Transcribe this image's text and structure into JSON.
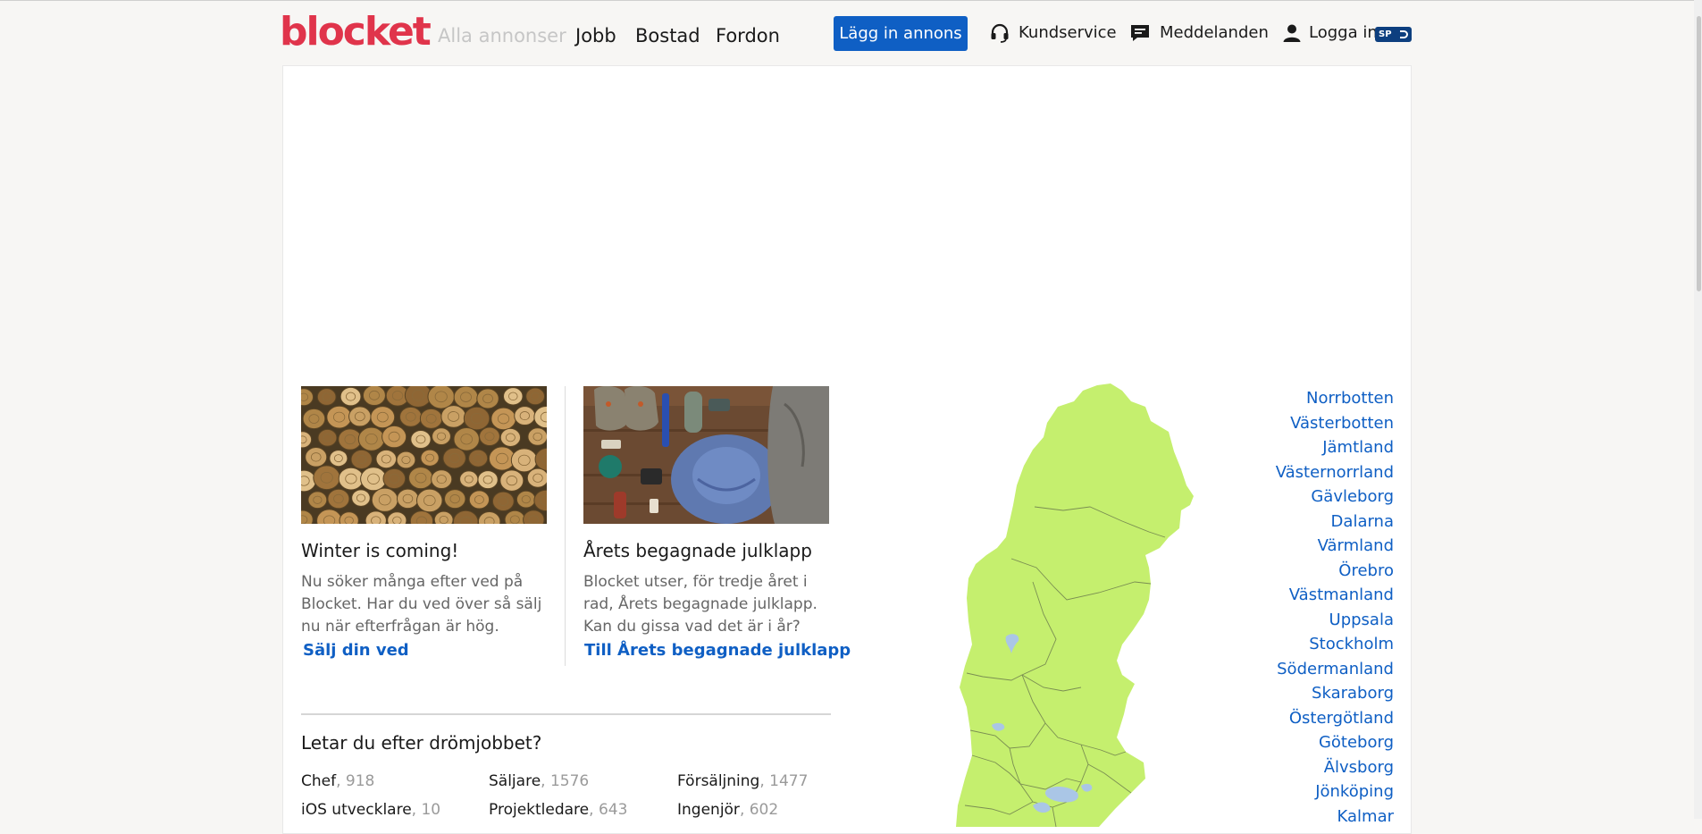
{
  "header": {
    "logo": "blocket",
    "nav": [
      "Alla annonser",
      "Jobb",
      "Bostad",
      "Fordon"
    ],
    "post_button": "Lägg in annons",
    "customer_service": "Kundservice",
    "messages": "Meddelanden",
    "login": "Logga in",
    "spid_badge": "SP"
  },
  "cards": [
    {
      "title": "Winter is coming!",
      "text": "Nu söker många efter ved på Blocket. Har du ved över så sälj nu när efterfrågan är hög.",
      "link": "Sälj din ved"
    },
    {
      "title": "Årets begagnade julklapp",
      "text": "Blocket utser, för tredje året i rad, Årets begagnade julklapp. Kan du gissa vad det är i år?",
      "link": "Till Årets begagnade julklapp"
    }
  ],
  "jobs": {
    "title": "Letar du efter drömjobbet?",
    "items": [
      {
        "name": "Chef",
        "count": ", 918"
      },
      {
        "name": "Säljare",
        "count": ", 1576"
      },
      {
        "name": "Försäljning",
        "count": ", 1477"
      },
      {
        "name": "iOS utvecklare",
        "count": ", 10"
      },
      {
        "name": "Projektledare",
        "count": ", 643"
      },
      {
        "name": "Ingenjör",
        "count": ", 602"
      }
    ]
  },
  "regions": [
    "Norrbotten",
    "Västerbotten",
    "Jämtland",
    "Västernorrland",
    "Gävleborg",
    "Dalarna",
    "Värmland",
    "Örebro",
    "Västmanland",
    "Uppsala",
    "Stockholm",
    "Södermanland",
    "Skaraborg",
    "Östergötland",
    "Göteborg",
    "Älvsborg",
    "Jönköping",
    "Kalmar"
  ],
  "colors": {
    "brand": "#e0344b",
    "link": "#0f5fc4",
    "map_fill": "#c5ef6e"
  }
}
